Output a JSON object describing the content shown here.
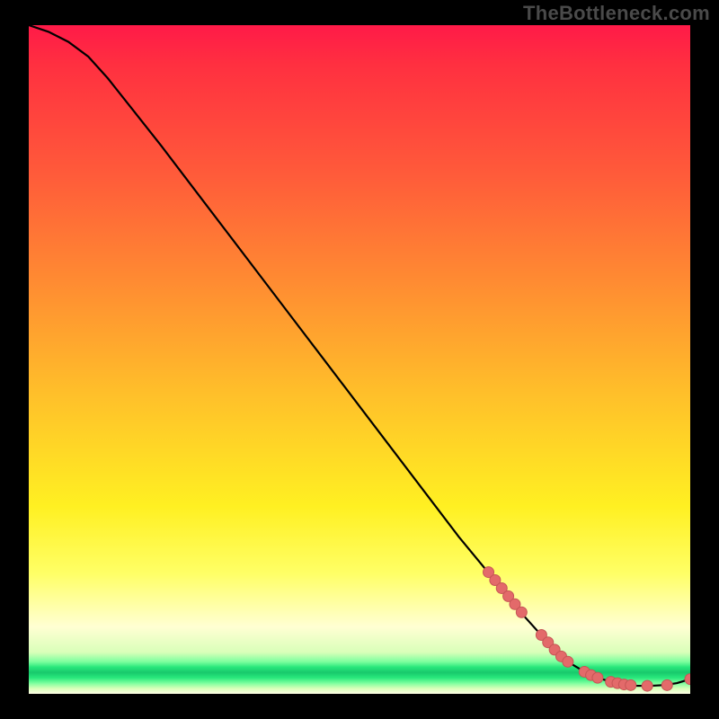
{
  "watermark": "TheBottleneck.com",
  "colors": {
    "line": "#000000",
    "marker_fill": "#e36a6a",
    "marker_stroke": "#c65555"
  },
  "chart_data": {
    "type": "line",
    "title": "",
    "xlabel": "",
    "ylabel": "",
    "xlim": [
      0,
      100
    ],
    "ylim": [
      0,
      100
    ],
    "grid": false,
    "series": [
      {
        "name": "curve",
        "x": [
          0,
          3,
          6,
          9,
          12,
          16,
          20,
          25,
          30,
          35,
          40,
          45,
          50,
          55,
          60,
          65,
          70,
          75,
          80,
          82,
          84,
          86,
          88,
          90,
          92,
          94,
          96,
          98,
          100
        ],
        "y": [
          100,
          99,
          97.5,
          95.3,
          92,
          87,
          82,
          75.5,
          69,
          62.5,
          56,
          49.5,
          43,
          36.5,
          30,
          23.5,
          17.5,
          11.5,
          6,
          4.5,
          3.3,
          2.4,
          1.8,
          1.4,
          1.2,
          1.2,
          1.3,
          1.6,
          2.2
        ]
      }
    ],
    "markers": [
      {
        "x": 69.5,
        "y": 18.2
      },
      {
        "x": 70.5,
        "y": 17.0
      },
      {
        "x": 71.5,
        "y": 15.8
      },
      {
        "x": 72.5,
        "y": 14.6
      },
      {
        "x": 73.5,
        "y": 13.4
      },
      {
        "x": 74.5,
        "y": 12.2
      },
      {
        "x": 77.5,
        "y": 8.8
      },
      {
        "x": 78.5,
        "y": 7.7
      },
      {
        "x": 79.5,
        "y": 6.6
      },
      {
        "x": 80.5,
        "y": 5.6
      },
      {
        "x": 81.5,
        "y": 4.8
      },
      {
        "x": 84.0,
        "y": 3.3
      },
      {
        "x": 85.0,
        "y": 2.8
      },
      {
        "x": 86.0,
        "y": 2.4
      },
      {
        "x": 88.0,
        "y": 1.8
      },
      {
        "x": 89.0,
        "y": 1.6
      },
      {
        "x": 90.0,
        "y": 1.4
      },
      {
        "x": 91.0,
        "y": 1.3
      },
      {
        "x": 93.5,
        "y": 1.2
      },
      {
        "x": 96.5,
        "y": 1.3
      },
      {
        "x": 100.0,
        "y": 2.2
      }
    ]
  }
}
